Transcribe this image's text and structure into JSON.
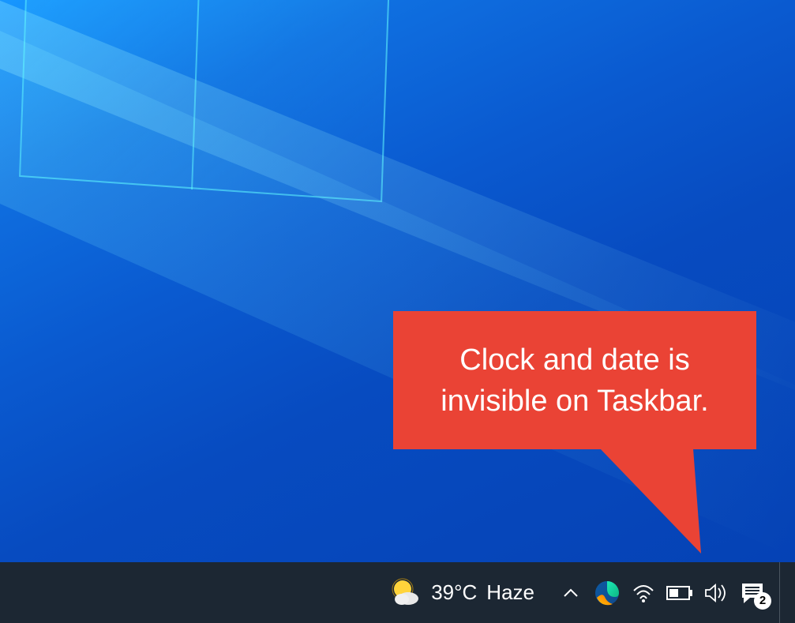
{
  "desktop": {
    "wallpaper": "windows-10-light-blue"
  },
  "callout": {
    "text": "Clock and date is invisible on Taskbar.",
    "color": "#ea4335"
  },
  "taskbar": {
    "weather": {
      "temperature": "39°C",
      "condition": "Haze",
      "icon": "sun-cloud"
    },
    "tray": {
      "chevron_icon": "chevron-up",
      "edge_icon": "microsoft-edge",
      "wifi_icon": "wifi",
      "battery_icon": "battery",
      "volume_icon": "speaker",
      "action_center_icon": "action-center",
      "notification_count": "2"
    }
  }
}
